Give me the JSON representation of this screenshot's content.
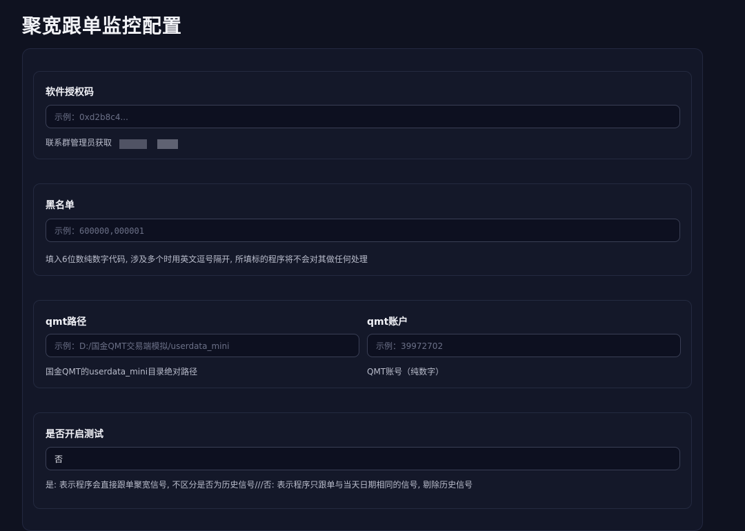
{
  "page": {
    "title": "聚宽跟单监控配置"
  },
  "license": {
    "label": "软件授权码",
    "placeholder": "示例：0xd2b8c4...",
    "hint": "联系群管理员获取"
  },
  "blacklist": {
    "label": "黑名单",
    "placeholder": "示例：600000,000001",
    "hint": "填入6位数纯数字代码, 涉及多个时用英文逗号隔开, 所填标的程序将不会对其做任何处理"
  },
  "qmt_path": {
    "label": "qmt路径",
    "placeholder": "示例：D:/国金QMT交易端模拟/userdata_mini",
    "hint": "国金QMT的userdata_mini目录绝对路径"
  },
  "qmt_account": {
    "label": "qmt账户",
    "placeholder": "示例：39972702",
    "hint": "QMT账号（纯数字）"
  },
  "test_mode": {
    "label": "是否开启测试",
    "value": "否",
    "hint": "是: 表示程序会直接跟单聚宽信号, 不区分是否为历史信号///否: 表示程序只跟单与当天日期相同的信号, 剔除历史信号"
  }
}
